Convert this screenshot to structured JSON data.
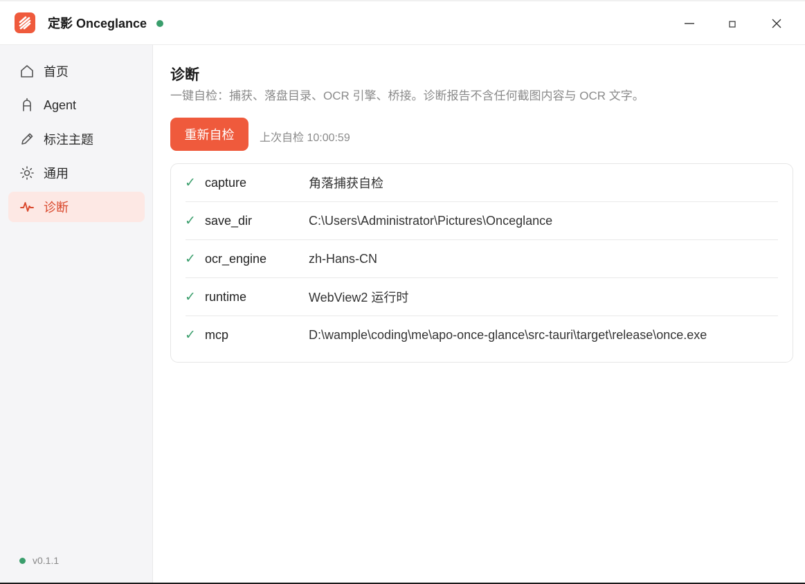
{
  "titlebar": {
    "title": "定影 Onceglance",
    "status_color": "#3a9e6c",
    "logo_icon": "onceglance-logo",
    "controls": [
      "minimize-icon",
      "maximize-icon",
      "close-icon"
    ]
  },
  "sidebar": {
    "items": [
      {
        "label": "首页",
        "icon": "home-icon",
        "active": false
      },
      {
        "label": "Agent",
        "icon": "agent-icon",
        "active": false
      },
      {
        "label": "标注主题",
        "icon": "pencil-icon",
        "active": false
      },
      {
        "label": "通用",
        "icon": "sun-gear-icon",
        "active": false
      },
      {
        "label": "诊断",
        "icon": "pulse-icon",
        "active": true
      }
    ],
    "version": "v0.1.1"
  },
  "main": {
    "title": "诊断",
    "description": "一键自检：捕获、落盘目录、OCR 引擎、桥接。诊断报告不含任何截图内容与 OCR 文字。",
    "rerun_label": "重新自检",
    "last_check": "上次自检 10:00:59",
    "results": [
      {
        "status": "✓",
        "key": "capture",
        "value": "角落捕获自检"
      },
      {
        "status": "✓",
        "key": "save_dir",
        "value": "C:\\Users\\Administrator\\Pictures\\Onceglance"
      },
      {
        "status": "✓",
        "key": "ocr_engine",
        "value": "zh-Hans-CN"
      },
      {
        "status": "✓",
        "key": "runtime",
        "value": "WebView2 运行时"
      },
      {
        "status": "✓",
        "key": "mcp",
        "value": "D:\\wample\\coding\\me\\apo-once-glance\\src-tauri\\target\\release\\once.exe"
      }
    ]
  },
  "colors": {
    "accent": "#ef5a3c",
    "active_bg": "#fde8e4",
    "active_text": "#d9472b",
    "ok_green": "#3a9e6c"
  }
}
